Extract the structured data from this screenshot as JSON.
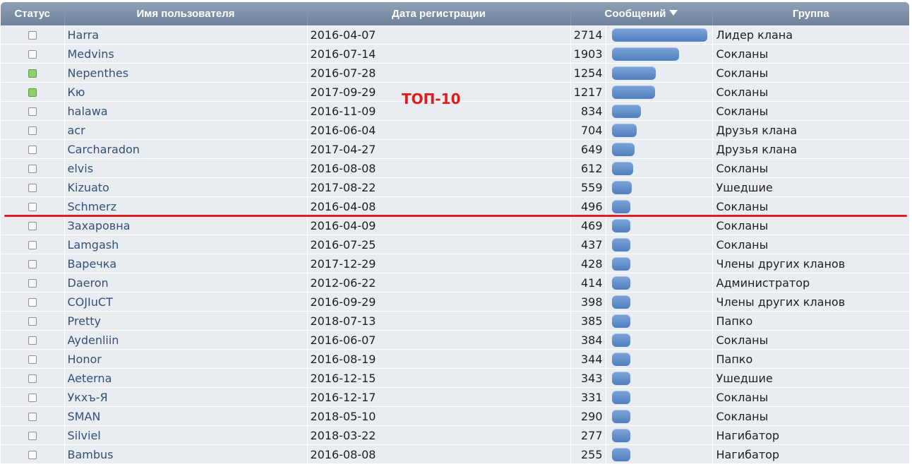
{
  "header": {
    "status": "Статус",
    "username": "Имя пользователя",
    "reg_date": "Дата регистрации",
    "posts": "Сообщений",
    "group": "Группа"
  },
  "annotation": {
    "label": "ТОП-10",
    "color": "#e01c1c",
    "line_color": "#e11d25"
  },
  "max_posts": 2714,
  "rows": [
    {
      "online": false,
      "name": "Harra",
      "date": "2016-04-07",
      "posts": 2714,
      "group": "Лидер клана"
    },
    {
      "online": false,
      "name": "Medvins",
      "date": "2016-07-14",
      "posts": 1903,
      "group": "Сокланы"
    },
    {
      "online": true,
      "name": "Nepenthes",
      "date": "2016-07-28",
      "posts": 1254,
      "group": "Сокланы"
    },
    {
      "online": true,
      "name": "Кю",
      "date": "2017-09-29",
      "posts": 1217,
      "group": "Сокланы"
    },
    {
      "online": false,
      "name": "halawa",
      "date": "2016-11-09",
      "posts": 834,
      "group": "Сокланы"
    },
    {
      "online": false,
      "name": "acr",
      "date": "2016-06-04",
      "posts": 704,
      "group": "Друзья клана"
    },
    {
      "online": false,
      "name": "Carcharadon",
      "date": "2017-04-27",
      "posts": 649,
      "group": "Друзья клана"
    },
    {
      "online": false,
      "name": "elvis",
      "date": "2016-08-08",
      "posts": 612,
      "group": "Сокланы"
    },
    {
      "online": false,
      "name": "Kizuato",
      "date": "2017-08-22",
      "posts": 559,
      "group": "Ушедшие"
    },
    {
      "online": false,
      "name": "Schmerz",
      "date": "2016-04-08",
      "posts": 496,
      "group": "Сокланы"
    },
    {
      "online": false,
      "name": "Захаровна",
      "date": "2016-04-09",
      "posts": 469,
      "group": "Сокланы"
    },
    {
      "online": false,
      "name": "Lamgash",
      "date": "2016-07-25",
      "posts": 437,
      "group": "Сокланы"
    },
    {
      "online": false,
      "name": "Варечка",
      "date": "2017-12-29",
      "posts": 428,
      "group": "Члены других кланов"
    },
    {
      "online": false,
      "name": "Daeron",
      "date": "2012-06-22",
      "posts": 414,
      "group": "Администратор"
    },
    {
      "online": false,
      "name": "COJIuCT",
      "date": "2016-09-29",
      "posts": 398,
      "group": "Члены других кланов"
    },
    {
      "online": false,
      "name": "Pretty",
      "date": "2018-07-13",
      "posts": 385,
      "group": "Папко"
    },
    {
      "online": false,
      "name": "Aydenliin",
      "date": "2016-06-07",
      "posts": 384,
      "group": "Сокланы"
    },
    {
      "online": false,
      "name": "Honor",
      "date": "2016-08-19",
      "posts": 344,
      "group": "Папко"
    },
    {
      "online": false,
      "name": "Aeterna",
      "date": "2016-12-15",
      "posts": 343,
      "group": "Ушедшие"
    },
    {
      "online": false,
      "name": "Укхъ-Я",
      "date": "2016-12-17",
      "posts": 331,
      "group": "Сокланы"
    },
    {
      "online": false,
      "name": "SMAN",
      "date": "2018-05-10",
      "posts": 290,
      "group": "Сокланы"
    },
    {
      "online": false,
      "name": "Silviel",
      "date": "2018-03-22",
      "posts": 277,
      "group": "Нагибатор"
    },
    {
      "online": false,
      "name": "Bambus",
      "date": "2016-08-08",
      "posts": 255,
      "group": "Нагибатор"
    }
  ]
}
